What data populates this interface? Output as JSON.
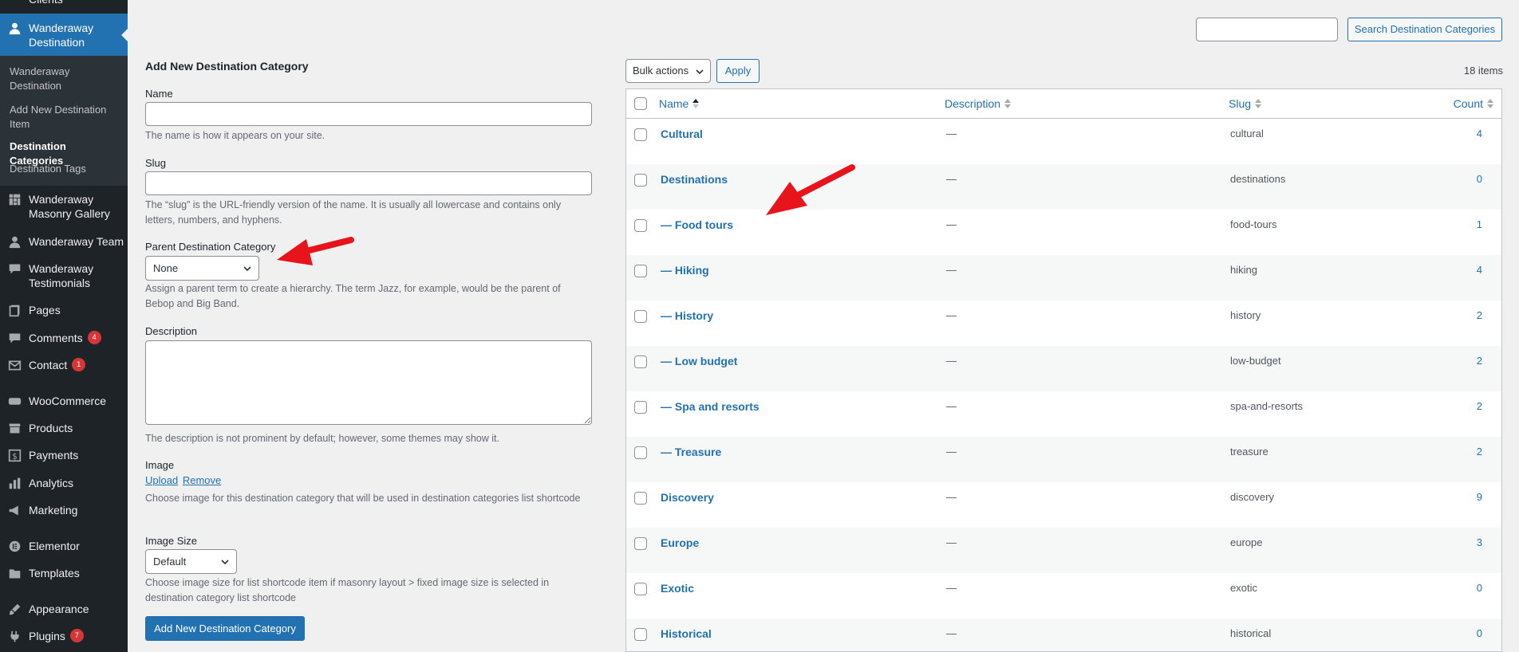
{
  "sidebar": {
    "top_partial": "Clients",
    "active": "Wanderaway Destination",
    "submenu": [
      "Wanderaway Destination",
      "Add New Destination Item",
      "Destination Categories",
      "Destination Tags"
    ],
    "items": [
      {
        "label": "Wanderaway Masonry Gallery",
        "icon": "grid-icon"
      },
      {
        "label": "Wanderaway Team",
        "icon": "user-icon"
      },
      {
        "label": "Wanderaway Testimonials",
        "icon": "speech-bubble-icon"
      },
      {
        "label": "Pages",
        "icon": "pages-icon"
      },
      {
        "label": "Comments",
        "icon": "comment-icon",
        "badge": "4"
      },
      {
        "label": "Contact",
        "icon": "envelope-icon",
        "badge": "1"
      },
      {
        "label": "WooCommerce",
        "icon": "woo-icon"
      },
      {
        "label": "Products",
        "icon": "archive-icon"
      },
      {
        "label": "Payments",
        "icon": "dollar-icon"
      },
      {
        "label": "Analytics",
        "icon": "bar-chart-icon"
      },
      {
        "label": "Marketing",
        "icon": "megaphone-icon"
      },
      {
        "label": "Elementor",
        "icon": "elementor-icon"
      },
      {
        "label": "Templates",
        "icon": "folder-icon"
      },
      {
        "label": "Appearance",
        "icon": "brush-icon"
      },
      {
        "label": "Plugins",
        "icon": "plug-icon",
        "badge": "7"
      }
    ]
  },
  "form": {
    "title": "Add New Destination Category",
    "name_label": "Name",
    "name_value": "",
    "name_help": "The name is how it appears on your site.",
    "slug_label": "Slug",
    "slug_value": "",
    "slug_help": "The “slug” is the URL-friendly version of the name. It is usually all lowercase and contains only letters, numbers, and hyphens.",
    "parent_label": "Parent Destination Category",
    "parent_value": "None",
    "parent_help": "Assign a parent term to create a hierarchy. The term Jazz, for example, would be the parent of Bebop and Big Band.",
    "description_label": "Description",
    "description_help": "The description is not prominent by default; however, some themes may show it.",
    "image_label": "Image",
    "upload_link": "Upload",
    "remove_link": "Remove",
    "image_help": "Choose image for this destination category that will be used in destination categories list shortcode",
    "image_size_label": "Image Size",
    "image_size_value": "Default",
    "image_size_help": "Choose image size for list shortcode item if masonry layout > fixed image size is selected in destination category list shortcode",
    "submit_label": "Add New Destination Category"
  },
  "toolbar": {
    "search_placeholder": "",
    "search_button": "Search Destination Categories",
    "bulk_actions": "Bulk actions",
    "apply": "Apply",
    "items_count": "18 items"
  },
  "table": {
    "columns": {
      "name": "Name",
      "description": "Description",
      "slug": "Slug",
      "count": "Count"
    },
    "rows": [
      {
        "name": "Cultural",
        "description": "—",
        "slug": "cultural",
        "count": "4"
      },
      {
        "name": "Destinations",
        "description": "—",
        "slug": "destinations",
        "count": "0"
      },
      {
        "name": "— Food tours",
        "description": "—",
        "slug": "food-tours",
        "count": "1"
      },
      {
        "name": "— Hiking",
        "description": "—",
        "slug": "hiking",
        "count": "4"
      },
      {
        "name": "— History",
        "description": "—",
        "slug": "history",
        "count": "2"
      },
      {
        "name": "— Low budget",
        "description": "—",
        "slug": "low-budget",
        "count": "2"
      },
      {
        "name": "— Spa and resorts",
        "description": "—",
        "slug": "spa-and-resorts",
        "count": "2"
      },
      {
        "name": "— Treasure",
        "description": "—",
        "slug": "treasure",
        "count": "2"
      },
      {
        "name": "Discovery",
        "description": "—",
        "slug": "discovery",
        "count": "9"
      },
      {
        "name": "Europe",
        "description": "—",
        "slug": "europe",
        "count": "3"
      },
      {
        "name": "Exotic",
        "description": "—",
        "slug": "exotic",
        "count": "0"
      },
      {
        "name": "Historical",
        "description": "—",
        "slug": "historical",
        "count": "0"
      }
    ]
  },
  "colors": {
    "accent": "#2271b1",
    "sidebar": "#1d2327",
    "badge": "#d63638",
    "annotation_arrow": "#e8141b"
  }
}
